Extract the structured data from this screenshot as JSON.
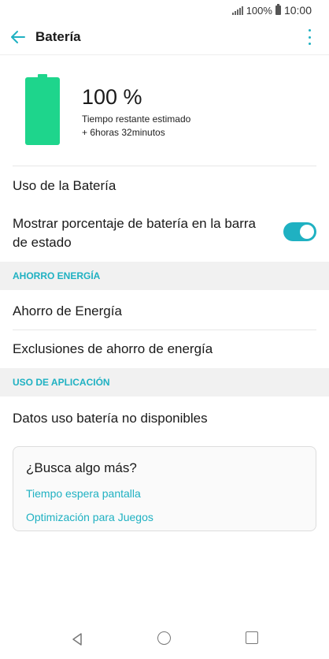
{
  "status_bar": {
    "battery_percent": "100%",
    "time": "10:00"
  },
  "app_bar": {
    "title": "Batería",
    "back_icon": "arrow-left-icon",
    "more_icon": "more-vertical-icon"
  },
  "battery": {
    "level_fraction": 1.0,
    "percent_text": "100 %",
    "remaining_label": "Tiempo restante estimado",
    "remaining_value": "+ 6horas 32minutos"
  },
  "items": {
    "usage": "Uso de la Batería",
    "show_percent_line1": "Mostrar porcentaje de batería en la barra",
    "show_percent_line2": "de estado",
    "show_percent_enabled": true
  },
  "sections": {
    "energy_saving": {
      "header": "AHORRO ENERGÍA",
      "items": [
        "Ahorro de Energía",
        "Exclusiones de ahorro de energía"
      ]
    },
    "app_usage": {
      "header": "USO DE APLICACIÓN",
      "items": [
        "Datos uso batería no disponibles"
      ]
    }
  },
  "search_card": {
    "title": "¿Busca algo más?",
    "links": [
      "Tiempo espera pantalla",
      "Optimización para Juegos"
    ]
  },
  "colors": {
    "accent": "#1fb1c2",
    "battery": "#1ed58c"
  }
}
